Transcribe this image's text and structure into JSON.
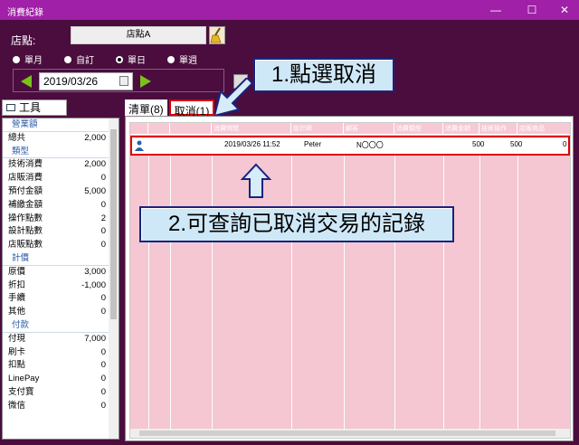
{
  "window": {
    "title": "消費紀錄",
    "min": "—",
    "max": "☐",
    "close": "✕"
  },
  "store": {
    "label": "店點:",
    "value": "店點A"
  },
  "radios": [
    {
      "label": "單月",
      "selected": false
    },
    {
      "label": "自訂",
      "selected": false
    },
    {
      "label": "單日",
      "selected": true
    },
    {
      "label": "單週",
      "selected": false
    }
  ],
  "date": "2019/03/26",
  "callouts": {
    "step1": "1.點選取消",
    "step2": "2.可查詢已取消交易的記錄"
  },
  "tools_tab": "工具",
  "summary": [
    {
      "label": "營業額",
      "head": true,
      "value": ""
    },
    {
      "label": "總共",
      "value": "2,000"
    },
    {
      "label": "類型",
      "head": true,
      "value": ""
    },
    {
      "label": "技術消費",
      "value": "2,000"
    },
    {
      "label": "店販消費",
      "value": "0"
    },
    {
      "label": "預付金額",
      "value": "5,000"
    },
    {
      "label": "補繳金額",
      "value": "0"
    },
    {
      "label": "操作點數",
      "value": "2"
    },
    {
      "label": "設計點數",
      "value": "0"
    },
    {
      "label": "店販點數",
      "value": "0"
    },
    {
      "label": "計價",
      "head": true,
      "value": ""
    },
    {
      "label": "原價",
      "value": "3,000"
    },
    {
      "label": "折扣",
      "value": "-1,000"
    },
    {
      "label": "手續",
      "value": "0"
    },
    {
      "label": "其他",
      "value": "0"
    },
    {
      "label": "付款",
      "head": true,
      "value": ""
    },
    {
      "label": "付現",
      "value": "7,000"
    },
    {
      "label": "刷卡",
      "value": "0"
    },
    {
      "label": "扣點",
      "value": "0"
    },
    {
      "label": "LinePay",
      "value": "0"
    },
    {
      "label": "支付寶",
      "value": "0"
    },
    {
      "label": "微信",
      "value": "0"
    }
  ],
  "tabs": [
    {
      "label": "清單(8)",
      "active": false
    },
    {
      "label": "取消(1)",
      "active": true
    }
  ],
  "grid": {
    "headers": [
      "消費時間",
      "設計師",
      "顧客",
      "消費類型",
      "消費金額",
      "技術操作",
      "店販商品"
    ],
    "row": [
      "2019/03/26 11:52",
      "Peter",
      "N〇〇〇",
      "",
      "500",
      "500",
      "0"
    ]
  },
  "colors": {
    "titlebar": "#a020a8",
    "background": "#4a0d3e",
    "highlight": "#e00000",
    "grid": "#f4c7d2"
  }
}
